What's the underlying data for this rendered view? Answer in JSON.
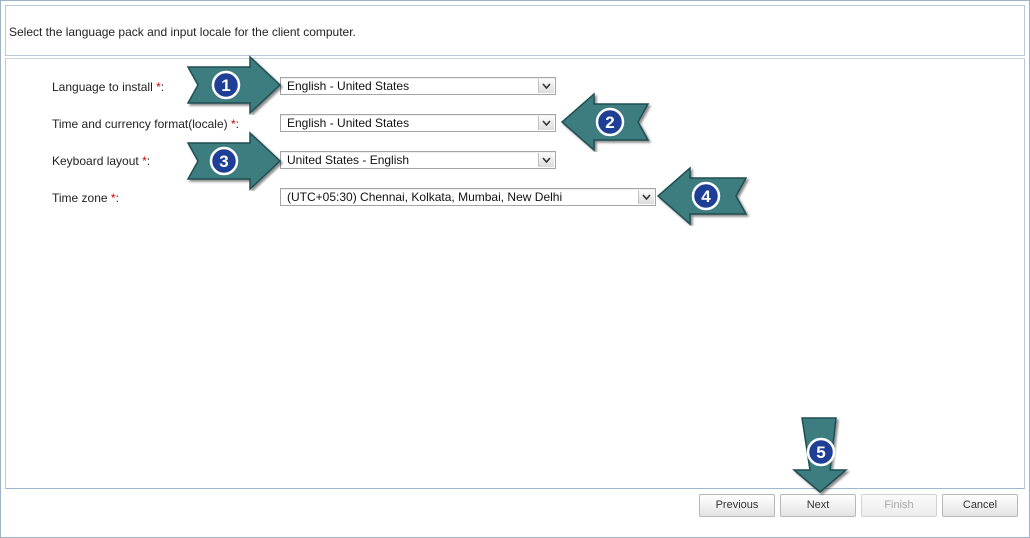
{
  "header": {
    "text": "Select the language pack and input locale for the client computer."
  },
  "form": {
    "required_marker": "*",
    "language": {
      "label": "Language to install",
      "suffix": ":",
      "value": "English - United States"
    },
    "locale": {
      "label": "Time and currency format(locale)",
      "suffix": ":",
      "value": "English - United States"
    },
    "keyboard": {
      "label": "Keyboard layout",
      "suffix": ":",
      "value": "United States - English"
    },
    "timezone": {
      "label": "Time zone",
      "suffix": ":",
      "value": "(UTC+05:30) Chennai, Kolkata, Mumbai, New Delhi"
    }
  },
  "buttons": {
    "previous": "Previous",
    "next": "Next",
    "finish": "Finish",
    "cancel": "Cancel"
  },
  "callouts": {
    "n1": "1",
    "n2": "2",
    "n3": "3",
    "n4": "4",
    "n5": "5"
  },
  "colors": {
    "arrow_fill": "#3d7d80",
    "badge_fill": "#1f3f96",
    "required": "#d10000",
    "panel_border": "#9ab7d4"
  },
  "icons": {
    "dropdown": "chevron-down-icon",
    "callout_arrow": "arrow-icon"
  }
}
